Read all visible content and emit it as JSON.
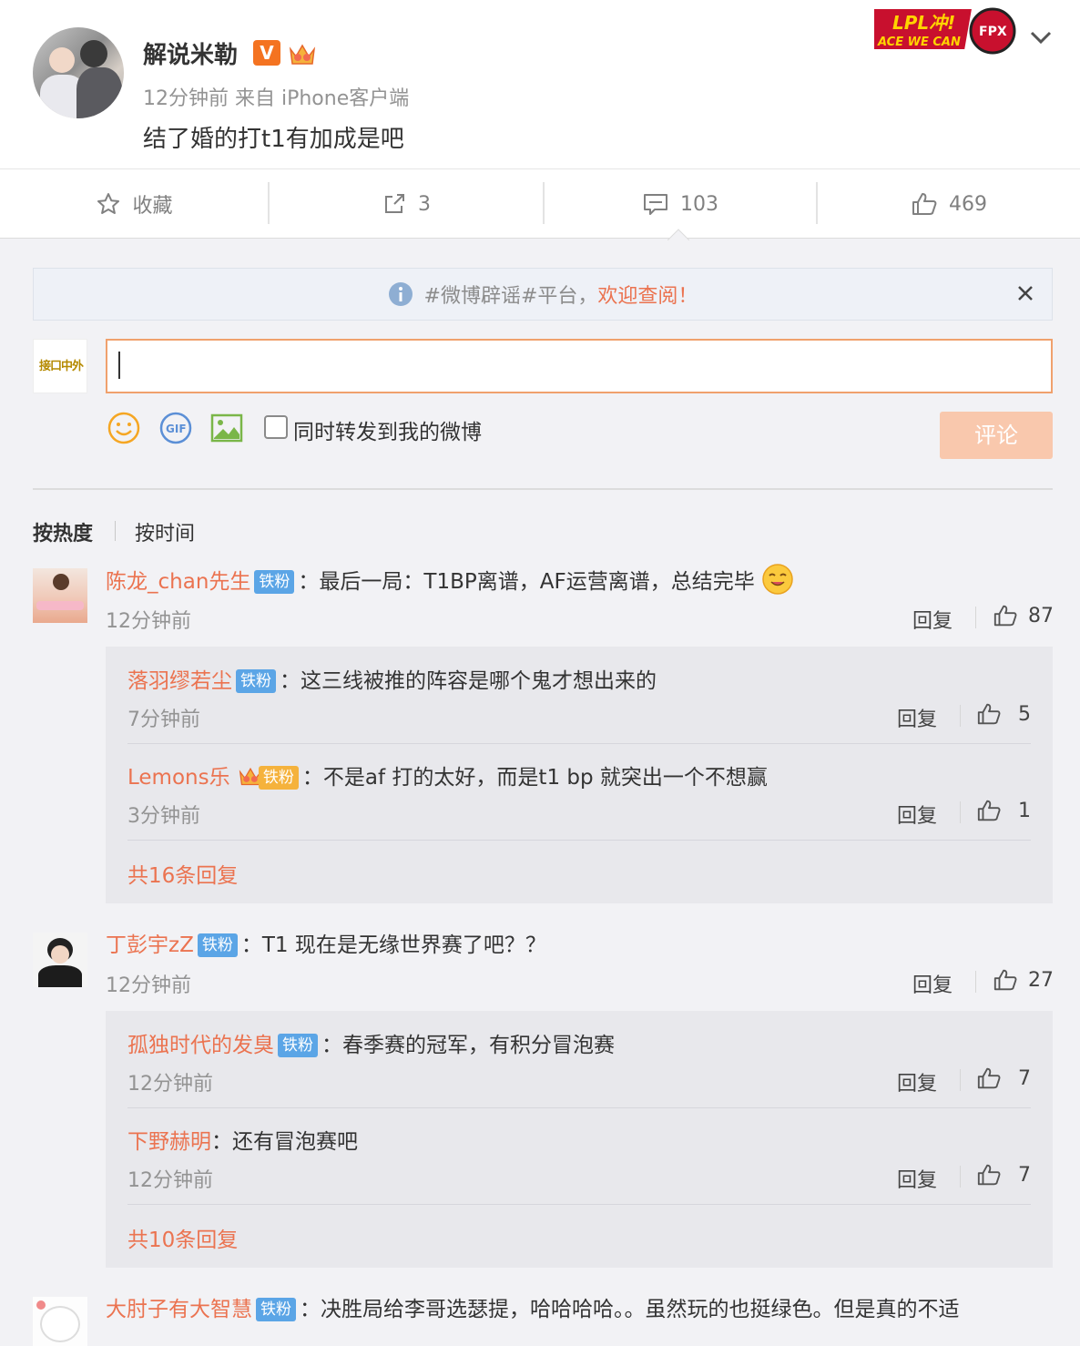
{
  "post": {
    "author": "解说米勒",
    "verified_badge": "V",
    "meta": "12分钟前 来自 iPhone客户端",
    "text": "结了婚的打t1有加成是吧",
    "event_logo_text": "LPL冲!",
    "event_logo_sub": "ACE WE CAN",
    "event_logo_team": "FPX"
  },
  "actions": {
    "favorite_label": "收藏",
    "repost_count": "3",
    "comment_count": "103",
    "like_count": "469"
  },
  "notice": {
    "topic": "#微博辟谣#平台，",
    "link": "欢迎查阅！"
  },
  "composer": {
    "my_avatar_text": "接口中外",
    "placeholder": "",
    "gif_label": "GIF",
    "repost_label": "同时转发到我的微博",
    "submit_label": "评论"
  },
  "sort": {
    "hot": "按热度",
    "time": "按时间"
  },
  "fan_label": "铁粉",
  "reply_label": "回复",
  "comments": [
    {
      "user": "陈龙_chan先生",
      "text": "：最后一局：T1BP离谱，AF运营离谱，总结完毕",
      "time": "12分钟前",
      "likes": "87",
      "replies": [
        {
          "user": "落羽缪若尘",
          "text": "：这三线被推的阵容是哪个鬼才想出来的",
          "time": "7分钟前",
          "likes": "5"
        },
        {
          "user": "Lemons乐",
          "text": "：不是af 打的太好，而是t1  bp 就突出一个不想赢",
          "time": "3分钟前",
          "likes": "1"
        }
      ],
      "more": "共16条回复"
    },
    {
      "user": "丁彭宇zZ",
      "text": "：T1 现在是无缘世界赛了吧？？",
      "time": "12分钟前",
      "likes": "27",
      "replies": [
        {
          "user": "孤独时代的发臭",
          "text": "：春季赛的冠军，有积分冒泡赛",
          "time": "12分钟前",
          "likes": "7"
        },
        {
          "user": "下野赫明",
          "text": "：还有冒泡赛吧",
          "time": "12分钟前",
          "likes": "7"
        }
      ],
      "more": "共10条回复"
    },
    {
      "user": "大肘子有大智慧",
      "text": "：决胜局给李哥选瑟提，哈哈哈哈。。虽然玩的也挺绿色。但是真的不适"
    }
  ],
  "colors": {
    "accent": "#eb7350",
    "fan_badge": "#5ba5e6",
    "submit_disabled": "#f9c8ad",
    "reply_bg": "#e8e8ec"
  }
}
